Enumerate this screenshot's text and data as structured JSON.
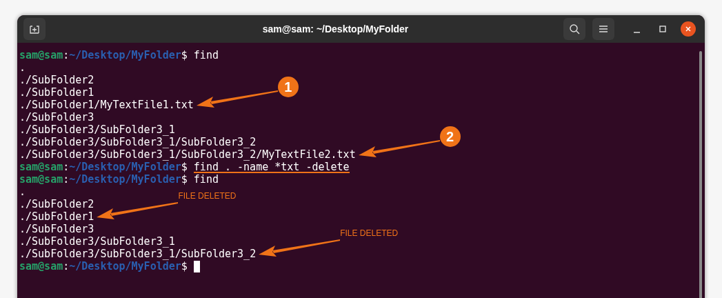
{
  "window": {
    "title": "sam@sam: ~/Desktop/MyFolder"
  },
  "terminal": {
    "lines": [
      {
        "kind": "prompt",
        "user": "sam@sam",
        "separator": ":",
        "path": "~/Desktop/MyFolder",
        "symbol": "$",
        "command": "find",
        "underlined": false,
        "cursor": false
      },
      {
        "kind": "output",
        "text": "."
      },
      {
        "kind": "output",
        "text": "./SubFolder2"
      },
      {
        "kind": "output",
        "text": "./SubFolder1"
      },
      {
        "kind": "output",
        "text": "./SubFolder1/MyTextFile1.txt",
        "annotation": {
          "kind": "badge",
          "text": "1"
        }
      },
      {
        "kind": "output",
        "text": "./SubFolder3"
      },
      {
        "kind": "output",
        "text": "./SubFolder3/SubFolder3_1"
      },
      {
        "kind": "output",
        "text": "./SubFolder3/SubFolder3_1/SubFolder3_2"
      },
      {
        "kind": "output",
        "text": "./SubFolder3/SubFolder3_1/SubFolder3_2/MyTextFile2.txt",
        "annotation": {
          "kind": "badge",
          "text": "2"
        }
      },
      {
        "kind": "prompt",
        "user": "sam@sam",
        "separator": ":",
        "path": "~/Desktop/MyFolder",
        "symbol": "$",
        "command": "find . -name *txt -delete",
        "underlined": true,
        "cursor": false
      },
      {
        "kind": "prompt",
        "user": "sam@sam",
        "separator": ":",
        "path": "~/Desktop/MyFolder",
        "symbol": "$",
        "command": "find",
        "underlined": false,
        "cursor": false
      },
      {
        "kind": "output",
        "text": "."
      },
      {
        "kind": "output",
        "text": "./SubFolder2"
      },
      {
        "kind": "output",
        "text": "./SubFolder1",
        "annotation": {
          "kind": "label",
          "text": "FILE DELETED"
        }
      },
      {
        "kind": "output",
        "text": "./SubFolder3"
      },
      {
        "kind": "output",
        "text": "./SubFolder3/SubFolder3_1"
      },
      {
        "kind": "output",
        "text": "./SubFolder3/SubFolder3_1/SubFolder3_2",
        "annotation": {
          "kind": "label",
          "text": "FILE DELETED"
        }
      },
      {
        "kind": "prompt",
        "user": "sam@sam",
        "separator": ":",
        "path": "~/Desktop/MyFolder",
        "symbol": "$",
        "underlined": false,
        "cursor": true
      }
    ]
  }
}
